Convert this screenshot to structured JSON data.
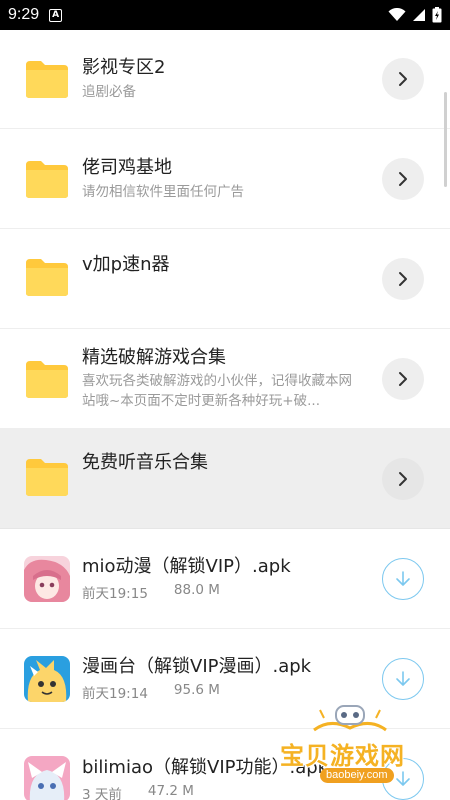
{
  "status_bar": {
    "time": "9:29",
    "notification_icon": "a-box-icon",
    "right_icons": [
      "wifi-icon",
      "signal-icon",
      "battery-charging-icon"
    ]
  },
  "items": [
    {
      "kind": "folder",
      "title": "影视专区2",
      "subtitle": "追剧必备",
      "action_icon": "chevron-right-icon"
    },
    {
      "kind": "folder",
      "title": "佬司鸡基地",
      "subtitle": "请勿相信软件里面任何广告",
      "action_icon": "chevron-right-icon"
    },
    {
      "kind": "folder",
      "title": "v加p速n器",
      "subtitle": "",
      "action_icon": "chevron-right-icon"
    },
    {
      "kind": "folder",
      "title": "精选破解游戏合集",
      "subtitle_line1": "喜欢玩各类破解游戏的小伙伴，记得收藏本网",
      "subtitle_line2": "站哦~本页面不定时更新各种好玩+破...",
      "action_icon": "chevron-right-icon"
    },
    {
      "kind": "folder",
      "title": "免费听音乐合集",
      "subtitle": "",
      "action_icon": "chevron-right-icon",
      "highlighted": true
    },
    {
      "kind": "file",
      "title": "mio动漫（解锁VIP）.apk",
      "date": "前天19:15",
      "size": "88.0 M",
      "action_icon": "download-icon"
    },
    {
      "kind": "file",
      "title": "漫画台（解锁VIP漫画）.apk",
      "date": "前天19:14",
      "size": "95.6 M",
      "action_icon": "download-icon"
    },
    {
      "kind": "file",
      "title": "bilimiao（解锁VIP功能）.apk",
      "date": "3 天前",
      "size": "47.2 M",
      "action_icon": "download-icon"
    }
  ],
  "watermark": {
    "text": "宝贝游戏网",
    "url": "baobeiy.com"
  },
  "colors": {
    "folder_yellow": "#ffd54f",
    "download_blue": "#7cc8ef",
    "highlight_bg": "#eeeeee",
    "watermark_orange": "#f5b223"
  }
}
